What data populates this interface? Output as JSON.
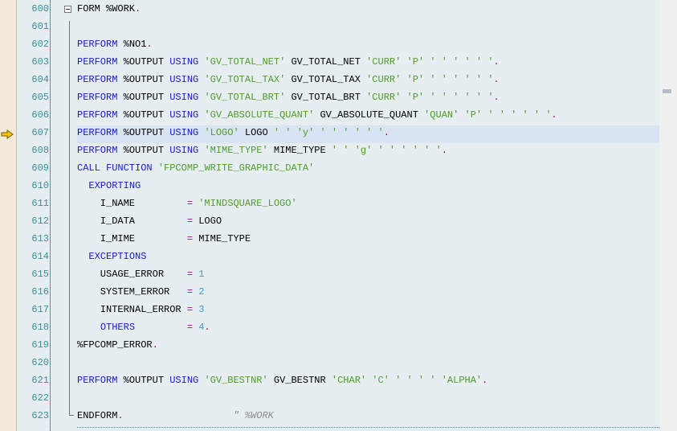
{
  "editor": {
    "current_line": 607,
    "colors": {
      "keyword": "#1a1acd",
      "string": "#4f9c2c",
      "number": "#3d9bdb",
      "operator": "#8b0f8b",
      "line_number": "#3b8e97",
      "highlight": "#d9e4f2"
    },
    "lines": [
      {
        "n": "600",
        "tokens": [
          [
            "t",
            "FORM %WORK"
          ],
          [
            "op",
            "."
          ]
        ]
      },
      {
        "n": "601",
        "tokens": []
      },
      {
        "n": "602",
        "tokens": [
          [
            "kw",
            "PERFORM"
          ],
          [
            "t",
            " %NO1"
          ],
          [
            "op",
            "."
          ]
        ]
      },
      {
        "n": "603",
        "tokens": [
          [
            "kw",
            "PERFORM"
          ],
          [
            "t",
            " %OUTPUT "
          ],
          [
            "kw",
            "USING"
          ],
          [
            "t",
            " "
          ],
          [
            "st",
            "'GV_TOTAL_NET'"
          ],
          [
            "t",
            " GV_TOTAL_NET "
          ],
          [
            "st",
            "'CURR' 'P' ' ' ' ' ' '"
          ],
          [
            "op",
            "."
          ]
        ]
      },
      {
        "n": "604",
        "tokens": [
          [
            "kw",
            "PERFORM"
          ],
          [
            "t",
            " %OUTPUT "
          ],
          [
            "kw",
            "USING"
          ],
          [
            "t",
            " "
          ],
          [
            "st",
            "'GV_TOTAL_TAX'"
          ],
          [
            "t",
            " GV_TOTAL_TAX "
          ],
          [
            "st",
            "'CURR' 'P' ' ' ' ' ' '"
          ],
          [
            "op",
            "."
          ]
        ]
      },
      {
        "n": "605",
        "tokens": [
          [
            "kw",
            "PERFORM"
          ],
          [
            "t",
            " %OUTPUT "
          ],
          [
            "kw",
            "USING"
          ],
          [
            "t",
            " "
          ],
          [
            "st",
            "'GV_TOTAL_BRT'"
          ],
          [
            "t",
            " GV_TOTAL_BRT "
          ],
          [
            "st",
            "'CURR' 'P' ' ' ' ' ' '"
          ],
          [
            "op",
            "."
          ]
        ]
      },
      {
        "n": "606",
        "tokens": [
          [
            "kw",
            "PERFORM"
          ],
          [
            "t",
            " %OUTPUT "
          ],
          [
            "kw",
            "USING"
          ],
          [
            "t",
            " "
          ],
          [
            "st",
            "'GV_ABSOLUTE_QUANT'"
          ],
          [
            "t",
            " GV_ABSOLUTE_QUANT "
          ],
          [
            "st",
            "'QUAN' 'P' ' ' ' ' ' '"
          ],
          [
            "op",
            "."
          ]
        ]
      },
      {
        "n": "607",
        "tokens": [
          [
            "kw",
            "PERFORM"
          ],
          [
            "t",
            " %OUTPUT "
          ],
          [
            "kw",
            "USING"
          ],
          [
            "t",
            " "
          ],
          [
            "st",
            "'LOGO'"
          ],
          [
            "t",
            " LOGO "
          ],
          [
            "st",
            "' ' 'y' ' ' ' ' ' '"
          ],
          [
            "op",
            "."
          ]
        ]
      },
      {
        "n": "608",
        "tokens": [
          [
            "kw",
            "PERFORM"
          ],
          [
            "t",
            " %OUTPUT "
          ],
          [
            "kw",
            "USING"
          ],
          [
            "t",
            " "
          ],
          [
            "st",
            "'MIME_TYPE'"
          ],
          [
            "t",
            " MIME_TYPE "
          ],
          [
            "st",
            "' ' 'g' ' ' ' ' ' '"
          ],
          [
            "op",
            "."
          ]
        ]
      },
      {
        "n": "609",
        "tokens": [
          [
            "kw",
            "CALL FUNCTION"
          ],
          [
            "t",
            " "
          ],
          [
            "st",
            "'FPCOMP_WRITE_GRAPHIC_DATA'"
          ]
        ]
      },
      {
        "n": "610",
        "tokens": [
          [
            "t",
            "  "
          ],
          [
            "kw",
            "EXPORTING"
          ]
        ]
      },
      {
        "n": "611",
        "tokens": [
          [
            "t",
            "    I_NAME         "
          ],
          [
            "op",
            "="
          ],
          [
            "t",
            " "
          ],
          [
            "st",
            "'MINDSQUARE_LOGO'"
          ]
        ]
      },
      {
        "n": "612",
        "tokens": [
          [
            "t",
            "    I_DATA         "
          ],
          [
            "op",
            "="
          ],
          [
            "t",
            " LOGO"
          ]
        ]
      },
      {
        "n": "613",
        "tokens": [
          [
            "t",
            "    I_MIME         "
          ],
          [
            "op",
            "="
          ],
          [
            "t",
            " MIME_TYPE"
          ]
        ]
      },
      {
        "n": "614",
        "tokens": [
          [
            "t",
            "  "
          ],
          [
            "kw",
            "EXCEPTIONS"
          ]
        ]
      },
      {
        "n": "615",
        "tokens": [
          [
            "t",
            "    USAGE_ERROR    "
          ],
          [
            "op",
            "="
          ],
          [
            "t",
            " "
          ],
          [
            "nm",
            "1"
          ]
        ]
      },
      {
        "n": "616",
        "tokens": [
          [
            "t",
            "    SYSTEM_ERROR   "
          ],
          [
            "op",
            "="
          ],
          [
            "t",
            " "
          ],
          [
            "nm",
            "2"
          ]
        ]
      },
      {
        "n": "617",
        "tokens": [
          [
            "t",
            "    INTERNAL_ERROR "
          ],
          [
            "op",
            "="
          ],
          [
            "t",
            " "
          ],
          [
            "nm",
            "3"
          ]
        ]
      },
      {
        "n": "618",
        "tokens": [
          [
            "t",
            "    "
          ],
          [
            "kw",
            "OTHERS"
          ],
          [
            "t",
            "         "
          ],
          [
            "op",
            "="
          ],
          [
            "t",
            " "
          ],
          [
            "nm",
            "4"
          ],
          [
            "op",
            "."
          ]
        ]
      },
      {
        "n": "619",
        "tokens": [
          [
            "t",
            "%FPCOMP_ERROR"
          ],
          [
            "op",
            "."
          ]
        ]
      },
      {
        "n": "620",
        "tokens": []
      },
      {
        "n": "621",
        "tokens": [
          [
            "kw",
            "PERFORM"
          ],
          [
            "t",
            " %OUTPUT "
          ],
          [
            "kw",
            "USING"
          ],
          [
            "t",
            " "
          ],
          [
            "st",
            "'GV_BESTNR'"
          ],
          [
            "t",
            " GV_BESTNR "
          ],
          [
            "st",
            "'CHAR' 'C' ' ' ' ' 'ALPHA'"
          ],
          [
            "op",
            "."
          ]
        ]
      },
      {
        "n": "622",
        "tokens": []
      },
      {
        "n": "623",
        "tokens": [
          [
            "t",
            "ENDFORM"
          ],
          [
            "op",
            "."
          ],
          [
            "t",
            "                   "
          ],
          [
            "cm",
            "\" %WORK"
          ]
        ]
      }
    ]
  }
}
